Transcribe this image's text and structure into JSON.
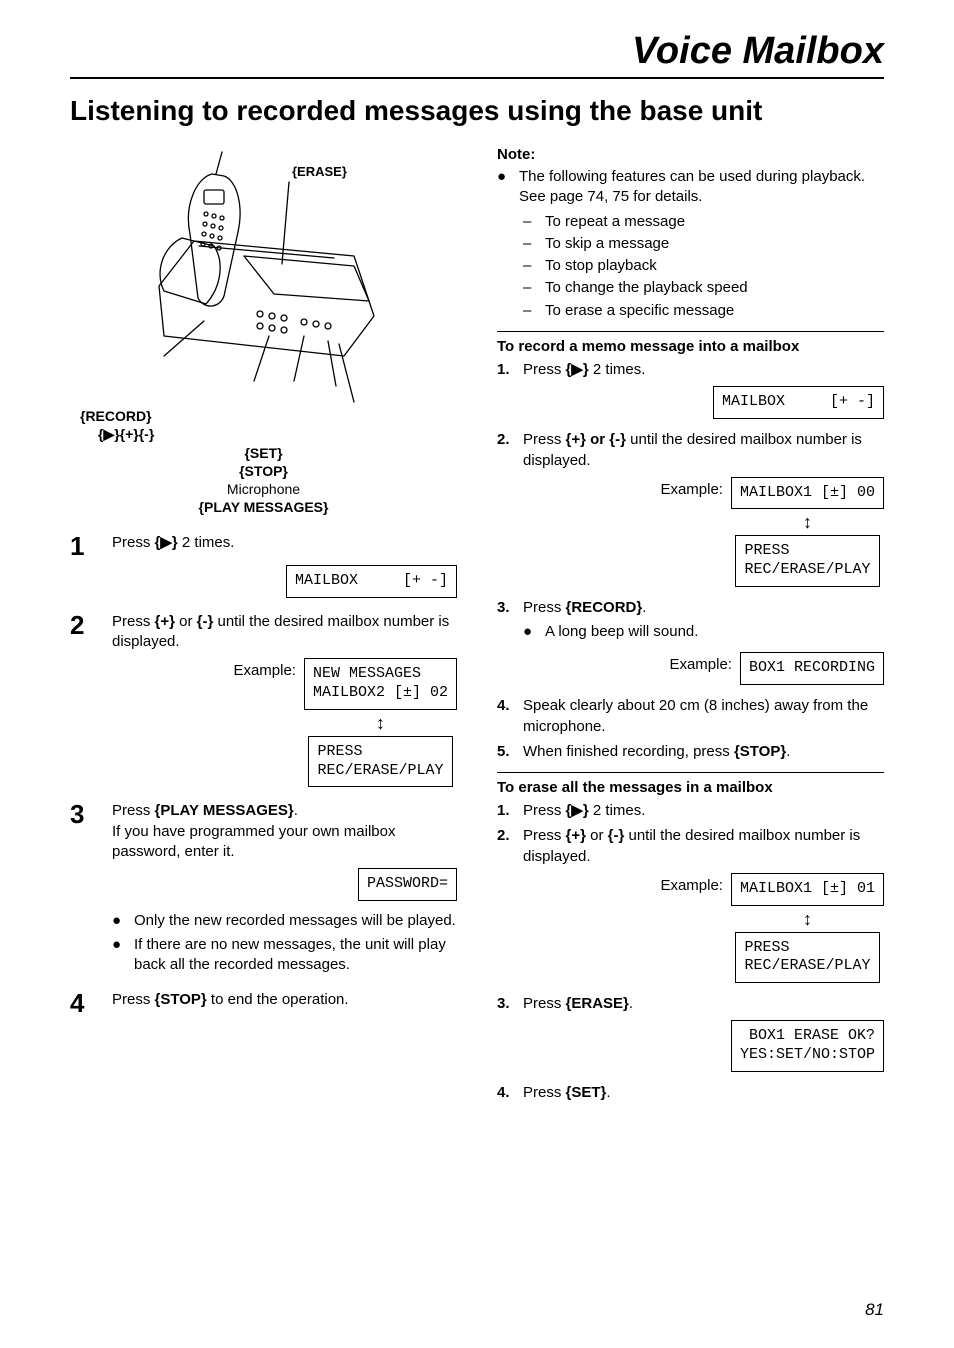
{
  "chapter": "Voice Mailbox",
  "section": "Listening to recorded messages using the base unit",
  "figure": {
    "labels": {
      "erase": "{ERASE}",
      "record": "{RECORD}",
      "keys": "{▶}{+}{-}",
      "set": "{SET}",
      "stop": "{STOP}",
      "microphone": "Microphone",
      "playMessages": "{PLAY MESSAGES}"
    }
  },
  "left": {
    "step1": {
      "text_a": "Press ",
      "key": "{▶}",
      "text_b": " 2 times.",
      "lcd": "MAILBOX     [+ -]"
    },
    "step2": {
      "text_a": "Press ",
      "key1": "{+}",
      "or": " or ",
      "key2": "{-}",
      "text_b": " until the desired mailbox number is displayed.",
      "example": "Example:",
      "lcd1": "NEW MESSAGES\nMAILBOX2 [±] 02",
      "lcd2": "PRESS\nREC/ERASE/PLAY"
    },
    "step3": {
      "text_a": "Press ",
      "key": "{PLAY MESSAGES}",
      "period": ".",
      "line2": "If you have programmed your own mailbox password, enter it.",
      "lcd": "PASSWORD=",
      "bullet1": "Only the new recorded messages will be played.",
      "bullet2": "If there are no new messages, the unit will play back all the recorded messages."
    },
    "step4": {
      "text_a": "Press ",
      "key": "{STOP}",
      "text_b": " to end the operation."
    }
  },
  "right": {
    "note": {
      "head": "Note:",
      "intro": "The following features can be used during playback. See page 74, 75 for details.",
      "items": [
        "To repeat a message",
        "To skip a message",
        "To stop playback",
        "To change the playback speed",
        "To erase a specific message"
      ]
    },
    "memo": {
      "head": "To record a memo message into a mailbox",
      "s1_a": "Press ",
      "s1_key": "{▶}",
      "s1_b": " 2 times.",
      "s1_lcd": "MAILBOX     [+ -]",
      "s2_a": "Press ",
      "s2_k1": "{+}",
      "s2_or": " or ",
      "s2_k2": "{-}",
      "s2_b": " until the desired mailbox number is displayed.",
      "s2_example": "Example:",
      "s2_lcd1": "MAILBOX1 [±] 00",
      "s2_lcd2": "PRESS\nREC/ERASE/PLAY",
      "s3_a": "Press ",
      "s3_key": "{RECORD}",
      "s3_b": ".",
      "s3_bullet": "A long beep will sound.",
      "s3_example": "Example:",
      "s3_lcd": "BOX1 RECORDING",
      "s4": "Speak clearly about 20 cm (8 inches) away from the microphone.",
      "s5_a": "When finished recording, press ",
      "s5_key": "{STOP}",
      "s5_b": "."
    },
    "erase": {
      "head": "To erase all the messages in a mailbox",
      "s1_a": "Press ",
      "s1_key": "{▶}",
      "s1_b": " 2 times.",
      "s2_a": "Press ",
      "s2_k1": "{+}",
      "s2_or": " or ",
      "s2_k2": "{-}",
      "s2_b": " until the desired mailbox number is displayed.",
      "s2_example": "Example:",
      "s2_lcd1": "MAILBOX1 [±] 01",
      "s2_lcd2": "PRESS\nREC/ERASE/PLAY",
      "s3_a": "Press ",
      "s3_key": "{ERASE}",
      "s3_b": ".",
      "s3_lcd": "BOX1 ERASE OK?\nYES:SET/NO:STOP",
      "s4_a": "Press ",
      "s4_key": "{SET}",
      "s4_b": "."
    }
  },
  "pageNumber": "81"
}
